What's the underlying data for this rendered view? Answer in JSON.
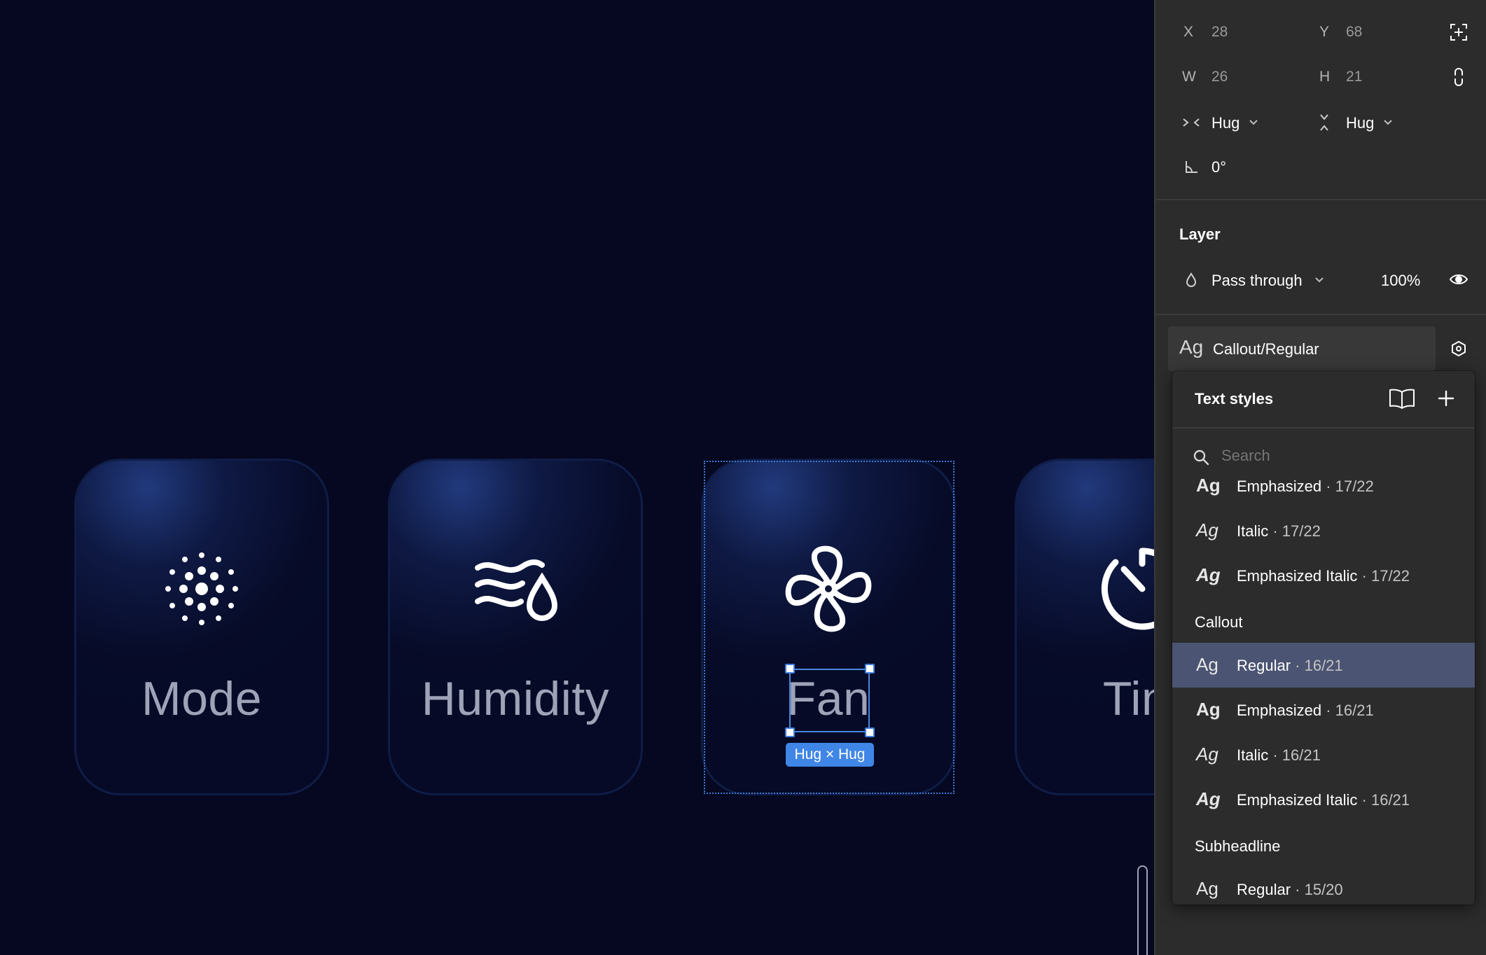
{
  "canvas": {
    "cards": [
      {
        "label": "Mode",
        "icon": "dots-icon"
      },
      {
        "label": "Humidity",
        "icon": "wind-drop-icon"
      },
      {
        "label": "Fan",
        "icon": "fan-icon"
      },
      {
        "label": "Tim",
        "icon": "timer-icon"
      }
    ],
    "selection_badge": "Hug × Hug"
  },
  "panel": {
    "x_label": "X",
    "x_value": "28",
    "y_label": "Y",
    "y_value": "68",
    "w_label": "W",
    "w_value": "26",
    "h_label": "H",
    "h_value": "21",
    "horizontal_resizing": "Hug",
    "vertical_resizing": "Hug",
    "rotation": "0°",
    "layer_title": "Layer",
    "blend_mode": "Pass through",
    "opacity": "100%",
    "text_style_ag": "Ag",
    "text_style_name": "Callout/Regular"
  },
  "text_styles_popup": {
    "title": "Text styles",
    "search_placeholder": "Search",
    "rows": [
      {
        "ag": "Ag",
        "name": "Emphasized",
        "meta": " · 17/22"
      },
      {
        "ag": "Ag",
        "name": "Italic",
        "meta": " · 17/22"
      },
      {
        "ag": "Ag",
        "name": "Emphasized Italic",
        "meta": " · 17/22"
      },
      {
        "group": "Callout"
      },
      {
        "ag": "Ag",
        "name": "Regular",
        "meta": " · 16/21",
        "selected": true
      },
      {
        "ag": "Ag",
        "name": "Emphasized",
        "meta": " · 16/21"
      },
      {
        "ag": "Ag",
        "name": "Italic",
        "meta": " · 16/21"
      },
      {
        "ag": "Ag",
        "name": "Emphasized Italic",
        "meta": " · 16/21"
      },
      {
        "group": "Subheadline"
      },
      {
        "ag": "Ag",
        "name": "Regular",
        "meta": " · 15/20"
      }
    ]
  },
  "colors": {
    "canvas_bg": "#050820",
    "panel_bg": "#2c2c2c",
    "selection_blue": "#3f86e6",
    "selected_row": "#4b5472"
  }
}
